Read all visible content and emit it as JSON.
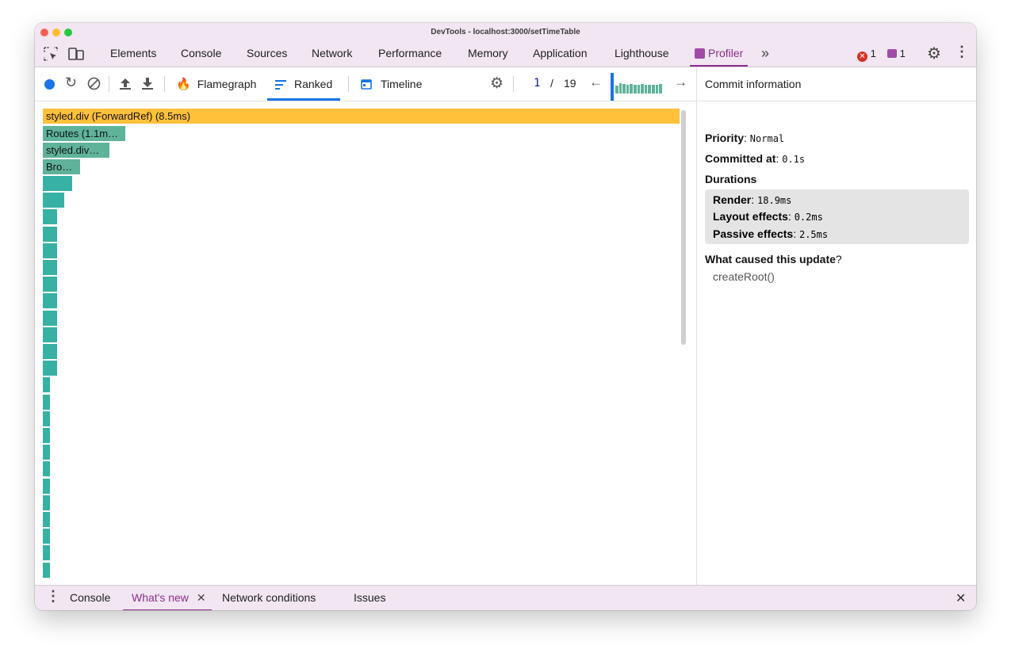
{
  "window": {
    "title": "DevTools - localhost:3000/setTimeTable"
  },
  "main_tabs": [
    "Elements",
    "Console",
    "Sources",
    "Network",
    "Performance",
    "Memory",
    "Application",
    "Lighthouse",
    "Profiler"
  ],
  "status": {
    "errors": "1",
    "messages": "1"
  },
  "profiler_toolbar": {
    "flamegraph": "Flamegraph",
    "ranked": "Ranked",
    "timeline": "Timeline",
    "commit_index": "1",
    "commit_sep": "/",
    "commit_total": "19"
  },
  "ranked_bars": [
    "styled.div (ForwardRef) (8.5ms)",
    "Routes (1.1m…",
    "styled.div…",
    "Bro…"
  ],
  "commit_info": {
    "header": "Commit information",
    "priority_label": "Priority",
    "priority_value": "Normal",
    "committed_label": "Committed at",
    "committed_value": "0.1s",
    "durations_label": "Durations",
    "render_label": "Render",
    "render_value": "18.9ms",
    "layout_label": "Layout effects",
    "layout_value": "0.2ms",
    "passive_label": "Passive effects",
    "passive_value": "2.5ms",
    "cause_label": "What caused this update",
    "cause_q": "?",
    "cause_value": "createRoot()"
  },
  "drawer_tabs": {
    "console": "Console",
    "whats_new": "What's new",
    "network_conditions": "Network conditions",
    "issues": "Issues"
  },
  "colors": {
    "accent": "#8b2f8b",
    "highlight_bar": "#ffc03a",
    "teal_bar": "#37b1a4",
    "muted_bar": "#5fb39b",
    "blue": "#1a73e8"
  }
}
